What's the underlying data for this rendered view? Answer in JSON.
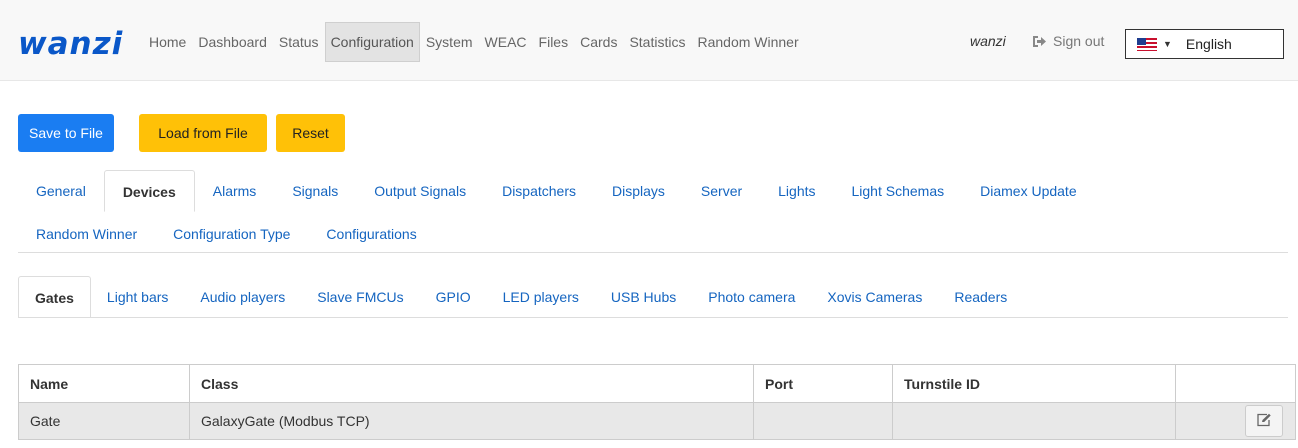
{
  "brand": "wanzi",
  "nav": {
    "items": [
      {
        "label": "Home"
      },
      {
        "label": "Dashboard"
      },
      {
        "label": "Status"
      },
      {
        "label": "Configuration",
        "active": true
      },
      {
        "label": "System"
      },
      {
        "label": "WEAC"
      },
      {
        "label": "Files"
      },
      {
        "label": "Cards"
      },
      {
        "label": "Statistics"
      },
      {
        "label": "Random Winner"
      }
    ],
    "user": "wanzi",
    "signout_label": "Sign out",
    "language": {
      "selected": "English",
      "flag_icon": "us-flag-icon"
    }
  },
  "actions": {
    "save_label": "Save to File",
    "load_label": "Load from File",
    "reset_label": "Reset"
  },
  "tabs": {
    "row1": [
      "General",
      "Devices",
      "Alarms",
      "Signals",
      "Output Signals",
      "Dispatchers",
      "Displays",
      "Server",
      "Lights",
      "Light Schemas",
      "Diamex Update"
    ],
    "row2": [
      "Random Winner",
      "Configuration Type",
      "Configurations"
    ],
    "active": "Devices"
  },
  "subtabs": {
    "items": [
      "Gates",
      "Light bars",
      "Audio players",
      "Slave FMCUs",
      "GPIO",
      "LED players",
      "USB Hubs",
      "Photo camera",
      "Xovis Cameras",
      "Readers"
    ],
    "active": "Gates"
  },
  "table": {
    "columns": [
      "Name",
      "Class",
      "Port",
      "Turnstile ID",
      ""
    ],
    "rows": [
      {
        "name": "Gate",
        "class": "GalaxyGate (Modbus TCP)",
        "port": "",
        "turnstile_id": ""
      }
    ]
  },
  "colors": {
    "brand": "#0a57c8",
    "primary": "#1a7df2",
    "warning": "#ffc107",
    "link": "#1565c0"
  }
}
